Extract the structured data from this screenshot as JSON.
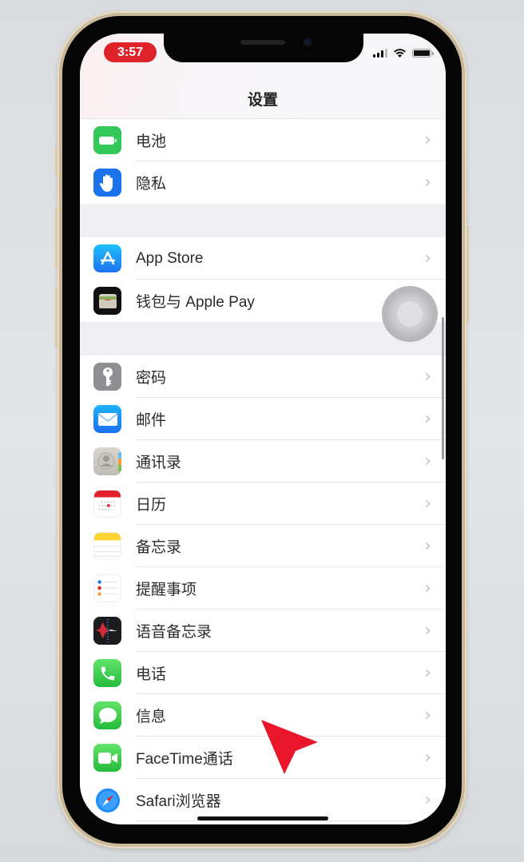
{
  "status_bar": {
    "time": "3:57",
    "time_pill_color": "#e0232b"
  },
  "nav": {
    "title": "设置"
  },
  "groups": [
    {
      "items": [
        {
          "label": "电池",
          "icon": "battery-icon",
          "icon_color": "#34c759"
        },
        {
          "label": "隐私",
          "icon": "hand-icon",
          "icon_color": "#1a73e8"
        }
      ]
    },
    {
      "items": [
        {
          "label": "App Store",
          "icon": "app-store-icon",
          "icon_color": "#1d8cf8"
        },
        {
          "label": "钱包与 Apple Pay",
          "icon": "wallet-icon",
          "icon_color": "#111111"
        }
      ]
    },
    {
      "items": [
        {
          "label": "密码",
          "icon": "key-icon",
          "icon_color": "#8e8e93"
        },
        {
          "label": "邮件",
          "icon": "mail-icon",
          "icon_color": "#1e90ff"
        },
        {
          "label": "通讯录",
          "icon": "contacts-icon",
          "icon_color": "#c8c6c0"
        },
        {
          "label": "日历",
          "icon": "calendar-icon",
          "icon_color": "#ffffff"
        },
        {
          "label": "备忘录",
          "icon": "notes-icon",
          "icon_color": "#ffd60a"
        },
        {
          "label": "提醒事项",
          "icon": "reminders-icon",
          "icon_color": "#ffffff"
        },
        {
          "label": "语音备忘录",
          "icon": "voice-memos-icon",
          "icon_color": "#1c1c1e"
        },
        {
          "label": "电话",
          "icon": "phone-icon",
          "icon_color": "#34c759"
        },
        {
          "label": "信息",
          "icon": "messages-icon",
          "icon_color": "#34c759"
        },
        {
          "label": "FaceTime通话",
          "icon": "facetime-icon",
          "icon_color": "#34c759"
        },
        {
          "label": "Safari浏览器",
          "icon": "safari-icon",
          "icon_color": "#1a7cf0"
        }
      ]
    }
  ],
  "chevron": "›",
  "annotation": {
    "pointer_color": "#e8152b"
  }
}
